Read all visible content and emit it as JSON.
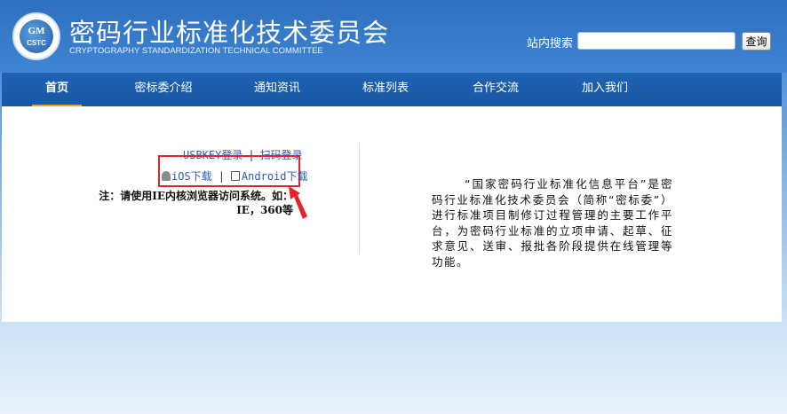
{
  "header": {
    "logo_text_main": "GM",
    "logo_text_sub": "CSTC",
    "title": "密码行业标准化技术委员会",
    "subtitle": "CRYPTOGRAPHY STANDARDIZATION TECHNICAL COMMITTEE",
    "search": {
      "label": "站内搜索",
      "value": "",
      "button_label": "查询"
    }
  },
  "nav": {
    "items": [
      {
        "label": "首页",
        "active": true
      },
      {
        "label": "密标委介绍",
        "active": false
      },
      {
        "label": "通知资讯",
        "active": false
      },
      {
        "label": "标准列表",
        "active": false
      },
      {
        "label": "合作交流",
        "active": false
      },
      {
        "label": "加入我们",
        "active": false
      }
    ]
  },
  "login": {
    "usbkey_label": "USBKEY登录",
    "separator": "|",
    "scan_label": "扫码登录",
    "ios_label": "iOS下载",
    "android_label": "Android下载",
    "notice": "注：请使用IE内核浏览器访问系统。如：IE，360等"
  },
  "intro": {
    "text": "“国家密码行业标准化信息平台”是密码行业标准化技术委员会（简称“密标委”）进行标准项目制修订过程管理的主要工作平台，为密码行业标准的立项申请、起草、征求意见、送审、报批各阶段提供在线管理等功能。"
  },
  "colors": {
    "nav_bg": "#1f63b3",
    "highlight_box": "#e0242c",
    "link": "#2a5db0"
  },
  "icons": [
    "logo-emblem",
    "android-icon",
    "book-icon",
    "red-arrow-icon"
  ]
}
